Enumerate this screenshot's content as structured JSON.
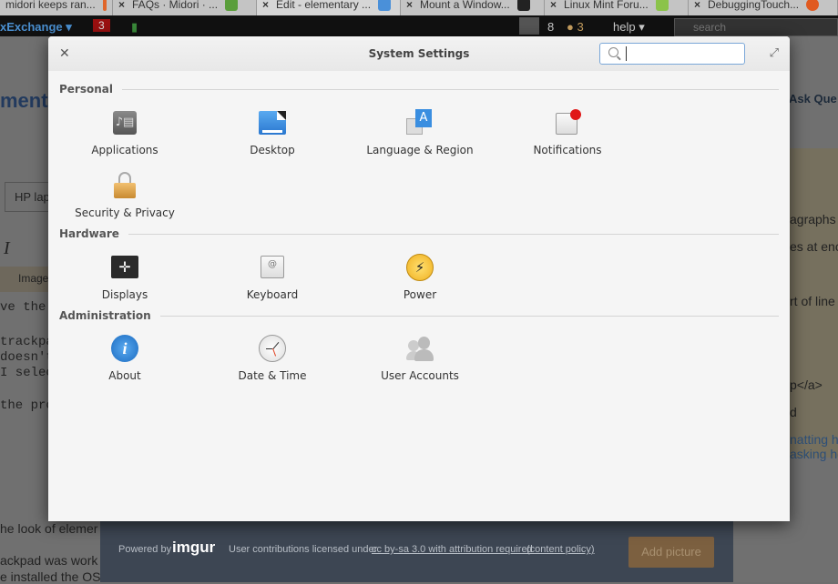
{
  "browser_tabs": [
    {
      "title": "midori keeps ran...",
      "color": "#e0662a"
    },
    {
      "title": "FAQs · Midori · ...",
      "color": "#5a9e3b"
    },
    {
      "title": "Edit - elementary ...",
      "color": "#4a90d9"
    },
    {
      "title": "Mount a Window...",
      "color": "#222"
    },
    {
      "title": "Linux Mint Foru...",
      "color": "#8bc34a"
    },
    {
      "title": "DebuggingTouch...",
      "color": "#e05a20"
    }
  ],
  "site_bar": {
    "brand": "xExchange ▾",
    "inbox_count": "3",
    "rep": "8",
    "badge": "● 3",
    "help": "help ▾",
    "search_placeholder": "search"
  },
  "background_page": {
    "heading": "menta",
    "ask": "Ask Que",
    "title_input": "HP lap",
    "italic": "I",
    "image_tab": "Image",
    "lines": [
      "ve the",
      "trackpa",
      "doesn't",
      "I selec",
      "the pro"
    ],
    "right_lines": [
      "agraphs",
      "es at enc",
      "rt of line",
      "p</a>",
      "d",
      "natting he",
      "asking he"
    ],
    "bottom_lines": [
      "he look of elemer",
      "ackpad was work",
      "e installed the OS"
    ]
  },
  "footer": {
    "powered_by": "Powered by",
    "logo": "imgur",
    "license_text": "User contributions licensed under",
    "license_link": "cc by-sa 3.0 with attribution required",
    "policy_link": "(content policy)",
    "add_picture": "Add picture"
  },
  "dialog": {
    "title": "System Settings",
    "search_value": "",
    "sections": [
      {
        "label": "Personal",
        "items": [
          {
            "label": "Applications",
            "icon": "applications-icon"
          },
          {
            "label": "Desktop",
            "icon": "desktop-icon"
          },
          {
            "label": "Language & Region",
            "icon": "language-icon"
          },
          {
            "label": "Notifications",
            "icon": "notifications-icon"
          },
          {
            "label": "Security & Privacy",
            "icon": "lock-icon"
          }
        ]
      },
      {
        "label": "Hardware",
        "items": [
          {
            "label": "Displays",
            "icon": "displays-icon"
          },
          {
            "label": "Keyboard",
            "icon": "keyboard-icon"
          },
          {
            "label": "Power",
            "icon": "power-icon"
          }
        ]
      },
      {
        "label": "Administration",
        "items": [
          {
            "label": "About",
            "icon": "info-icon"
          },
          {
            "label": "Date & Time",
            "icon": "clock-icon"
          },
          {
            "label": "User Accounts",
            "icon": "users-icon"
          }
        ]
      }
    ]
  }
}
